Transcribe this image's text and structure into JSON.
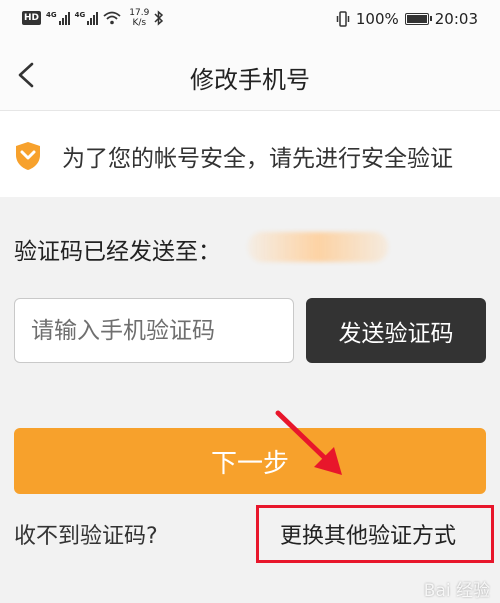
{
  "status_bar": {
    "hd": "HD",
    "signal_label": "4G",
    "signal_label_2": "4G",
    "net_speed_value": "17.9",
    "net_speed_unit": "K/s",
    "battery_percent": "100%",
    "time": "20:03"
  },
  "header": {
    "title": "修改手机号"
  },
  "notice": {
    "text": "为了您的帐号安全，请先进行安全验证"
  },
  "verification": {
    "sent_label": "验证码已经发送至：",
    "input_placeholder": "请输入手机验证码",
    "send_button": "发送验证码",
    "next_button": "下一步",
    "no_code_link": "收不到验证码?",
    "switch_method_link": "更换其他验证方式"
  },
  "watermark": {
    "text": "Bai 经验"
  },
  "colors": {
    "accent": "#f7a12c",
    "dark_button": "#333333",
    "annotation_red": "#e8162b"
  }
}
